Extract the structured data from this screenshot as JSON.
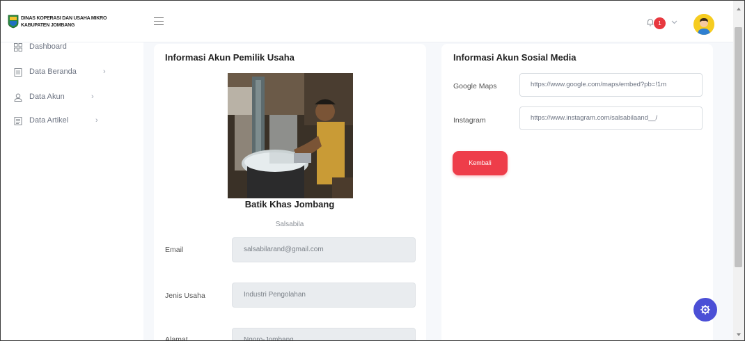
{
  "header": {
    "org_line1": "DINAS KOPERASI DAN USAHA MIKRO",
    "org_line2": "KABUPATEN JOMBANG",
    "notification_count": "1"
  },
  "sidebar": {
    "items": [
      {
        "label": "Dashboard",
        "icon": "grid-icon"
      },
      {
        "label": "Data Beranda",
        "icon": "document-icon"
      },
      {
        "label": "Data Akun",
        "icon": "user-icon"
      },
      {
        "label": "Data Artikel",
        "icon": "article-icon"
      }
    ]
  },
  "owner_card": {
    "title": "Informasi Akun Pemilik Usaha",
    "business_name": "Batik Khas Jombang",
    "owner_name": "Salsabila",
    "fields": [
      {
        "label": "Email",
        "value": "salsabilarand@gmail.com"
      },
      {
        "label": "Jenis Usaha",
        "value": "Industri Pengolahan"
      },
      {
        "label": "Alamat",
        "value": "Ngoro-Jombang"
      }
    ]
  },
  "social_card": {
    "title": "Informasi Akun Sosial Media",
    "fields": [
      {
        "label": "Google Maps",
        "value": "https://www.google.com/maps/embed?pb=!1m"
      },
      {
        "label": "Instagram",
        "value": "https://www.instagram.com/salsabilaand__/"
      }
    ],
    "back_button": "Kembali"
  },
  "colors": {
    "accent_red": "#ee3d4a",
    "fab_blue": "#4b4fd6",
    "badge_red": "#e8383f"
  }
}
